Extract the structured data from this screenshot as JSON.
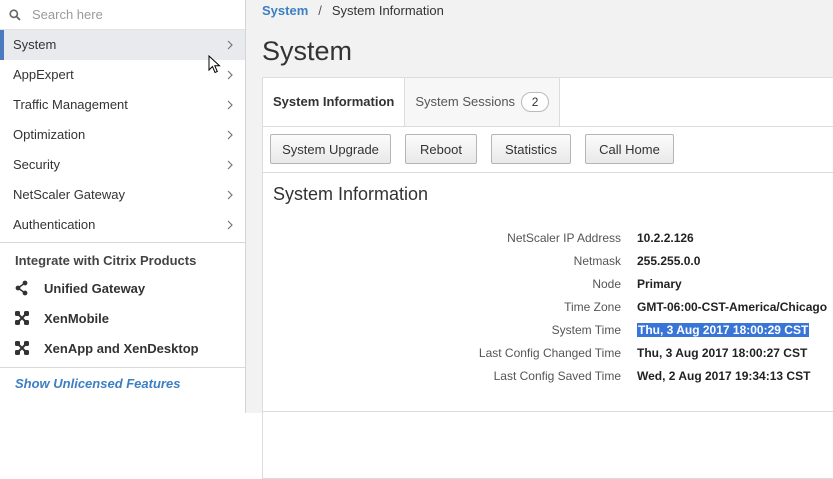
{
  "search": {
    "placeholder": "Search here"
  },
  "sidebar": {
    "items": [
      {
        "label": "System"
      },
      {
        "label": "AppExpert"
      },
      {
        "label": "Traffic Management"
      },
      {
        "label": "Optimization"
      },
      {
        "label": "Security"
      },
      {
        "label": "NetScaler Gateway"
      },
      {
        "label": "Authentication"
      }
    ],
    "integrate_title": "Integrate with Citrix Products",
    "integrate_items": [
      {
        "label": "Unified Gateway",
        "icon": "share-icon"
      },
      {
        "label": "XenMobile",
        "icon": "xenmobile-icon"
      },
      {
        "label": "XenApp and XenDesktop",
        "icon": "xenapp-icon"
      }
    ],
    "show_unlicensed": "Show Unlicensed Features"
  },
  "breadcrumb": {
    "parent": "System",
    "separator": "/",
    "current": "System Information"
  },
  "page": {
    "title": "System"
  },
  "tabs": [
    {
      "label": "System Information"
    },
    {
      "label": "System Sessions",
      "count": "2"
    }
  ],
  "toolbar": {
    "buttons": [
      {
        "label": "System Upgrade"
      },
      {
        "label": "Reboot"
      },
      {
        "label": "Statistics"
      },
      {
        "label": "Call Home"
      }
    ]
  },
  "system_info": {
    "title": "System Information",
    "rows": [
      {
        "label": "NetScaler IP Address",
        "value": "10.2.2.126"
      },
      {
        "label": "Netmask",
        "value": "255.255.0.0"
      },
      {
        "label": "Node",
        "value": "Primary"
      },
      {
        "label": "Time Zone",
        "value": "GMT-06:00-CST-America/Chicago"
      },
      {
        "label": "System Time",
        "value": "Thu, 3 Aug 2017 18:00:29 CST"
      },
      {
        "label": "Last Config Changed Time",
        "value": "Thu, 3 Aug 2017 18:00:27 CST"
      },
      {
        "label": "Last Config Saved Time",
        "value": "Wed, 2 Aug 2017 19:34:13 CST"
      }
    ]
  },
  "colors": {
    "accent": "#4a7bc0",
    "link": "#3c7fc2",
    "selection": "#3875d7"
  }
}
